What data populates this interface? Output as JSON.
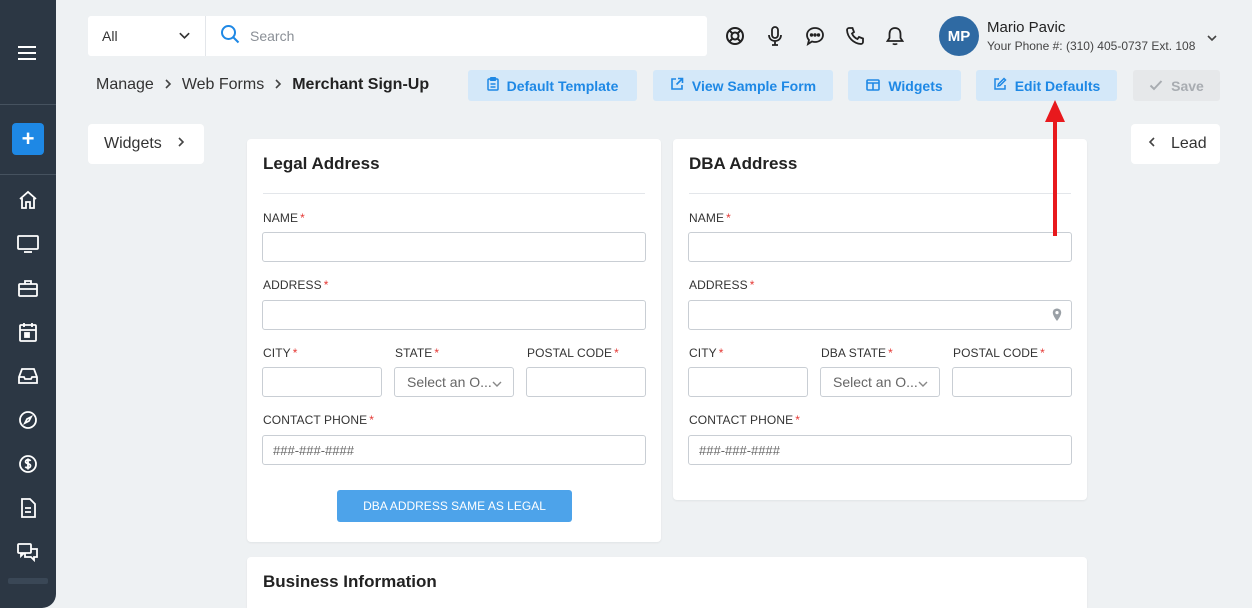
{
  "search": {
    "scope": "All",
    "placeholder": "Search"
  },
  "user": {
    "initials": "MP",
    "name": "Mario Pavic",
    "phone": "Your Phone #: (310) 405-0737 Ext. 108"
  },
  "breadcrumb": {
    "items": [
      "Manage",
      "Web Forms"
    ],
    "current": "Merchant Sign-Up"
  },
  "actions": {
    "default_template": "Default Template",
    "view_sample_form": "View Sample Form",
    "widgets": "Widgets",
    "edit_defaults": "Edit Defaults",
    "save": "Save"
  },
  "side": {
    "widgets": "Widgets",
    "lead": "Lead"
  },
  "legal": {
    "title": "Legal Address",
    "name_label": "NAME",
    "address_label": "ADDRESS",
    "city_label": "CITY",
    "state_label": "STATE",
    "state_placeholder": "Select an O...",
    "postal_label": "POSTAL CODE",
    "phone_label": "CONTACT PHONE",
    "phone_placeholder": "###-###-####",
    "same_button": "DBA ADDRESS SAME AS LEGAL",
    "required_mark": "*"
  },
  "dba": {
    "title": "DBA Address",
    "name_label": "NAME",
    "address_label": "ADDRESS",
    "city_label": "CITY",
    "state_label": "DBA STATE",
    "state_placeholder": "Select an O...",
    "postal_label": "POSTAL CODE",
    "phone_label": "CONTACT PHONE",
    "phone_placeholder": "###-###-####"
  },
  "business": {
    "title": "Business Information"
  },
  "colors": {
    "sidebar": "#2c3744",
    "accent": "#1e88e5",
    "action_bg": "#d4e8f9",
    "annotation_arrow": "#e8191d"
  }
}
